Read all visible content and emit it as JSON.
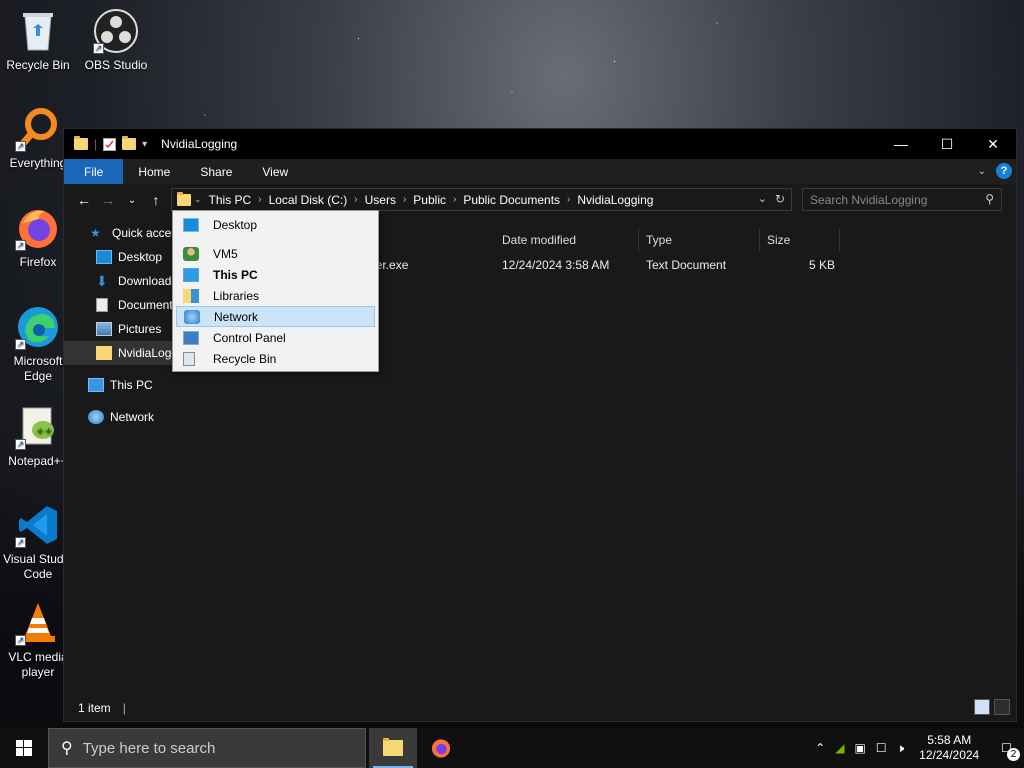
{
  "desktop": {
    "icons": [
      {
        "label": "Recycle Bin",
        "icon": "recycle-bin-icon"
      },
      {
        "label": "OBS Studio",
        "icon": "obs-studio-icon"
      },
      {
        "label": "Everything",
        "icon": "everything-icon"
      },
      {
        "label": "Firefox",
        "icon": "firefox-icon"
      },
      {
        "label": "Microsoft Edge",
        "icon": "edge-icon"
      },
      {
        "label": "Notepad++",
        "icon": "notepad-plus-plus-icon"
      },
      {
        "label": "Visual Studio Code",
        "icon": "vscode-icon"
      },
      {
        "label": "VLC media player",
        "icon": "vlc-icon"
      }
    ]
  },
  "window": {
    "title": "NvidiaLogging",
    "controls": {
      "minimize": "—",
      "maximize": "☐",
      "close": "✕"
    }
  },
  "ribbon": {
    "tabs": [
      "File",
      "Home",
      "Share",
      "View"
    ]
  },
  "address": {
    "crumbs": [
      "This PC",
      "Local Disk (C:)",
      "Users",
      "Public",
      "Public Documents",
      "NvidiaLogging"
    ]
  },
  "search": {
    "placeholder": "Search NvidiaLogging"
  },
  "nav_pane": {
    "items": [
      {
        "label": "Quick access",
        "icon": "star-icon"
      },
      {
        "label": "Desktop",
        "icon": "desktop-icon"
      },
      {
        "label": "Downloads",
        "icon": "download-icon"
      },
      {
        "label": "Documents",
        "icon": "documents-icon"
      },
      {
        "label": "Pictures",
        "icon": "pictures-icon"
      },
      {
        "label": "NvidiaLogging",
        "icon": "folder-icon"
      },
      {
        "label": "This PC",
        "icon": "this-pc-icon"
      },
      {
        "label": "Network",
        "icon": "network-icon"
      }
    ]
  },
  "columns": [
    "Date modified",
    "Type",
    "Size"
  ],
  "files": [
    {
      "name_visible": "ner.exe",
      "date": "12/24/2024 3:58 AM",
      "type": "Text Document",
      "size": "5 KB"
    }
  ],
  "dropdown": {
    "items": [
      {
        "label": "Desktop",
        "icon": "desktop-icon"
      },
      {
        "label": "VM5",
        "icon": "user-icon"
      },
      {
        "label": "This PC",
        "icon": "this-pc-icon",
        "bold": true
      },
      {
        "label": "Libraries",
        "icon": "libraries-icon"
      },
      {
        "label": "Network",
        "icon": "network-icon",
        "hover": true
      },
      {
        "label": "Control Panel",
        "icon": "control-panel-icon"
      },
      {
        "label": "Recycle Bin",
        "icon": "recycle-bin-icon"
      }
    ]
  },
  "status": {
    "count": "1 item"
  },
  "taskbar": {
    "search_placeholder": "Type here to search",
    "time": "5:58 AM",
    "date": "12/24/2024",
    "notification_count": "2"
  }
}
